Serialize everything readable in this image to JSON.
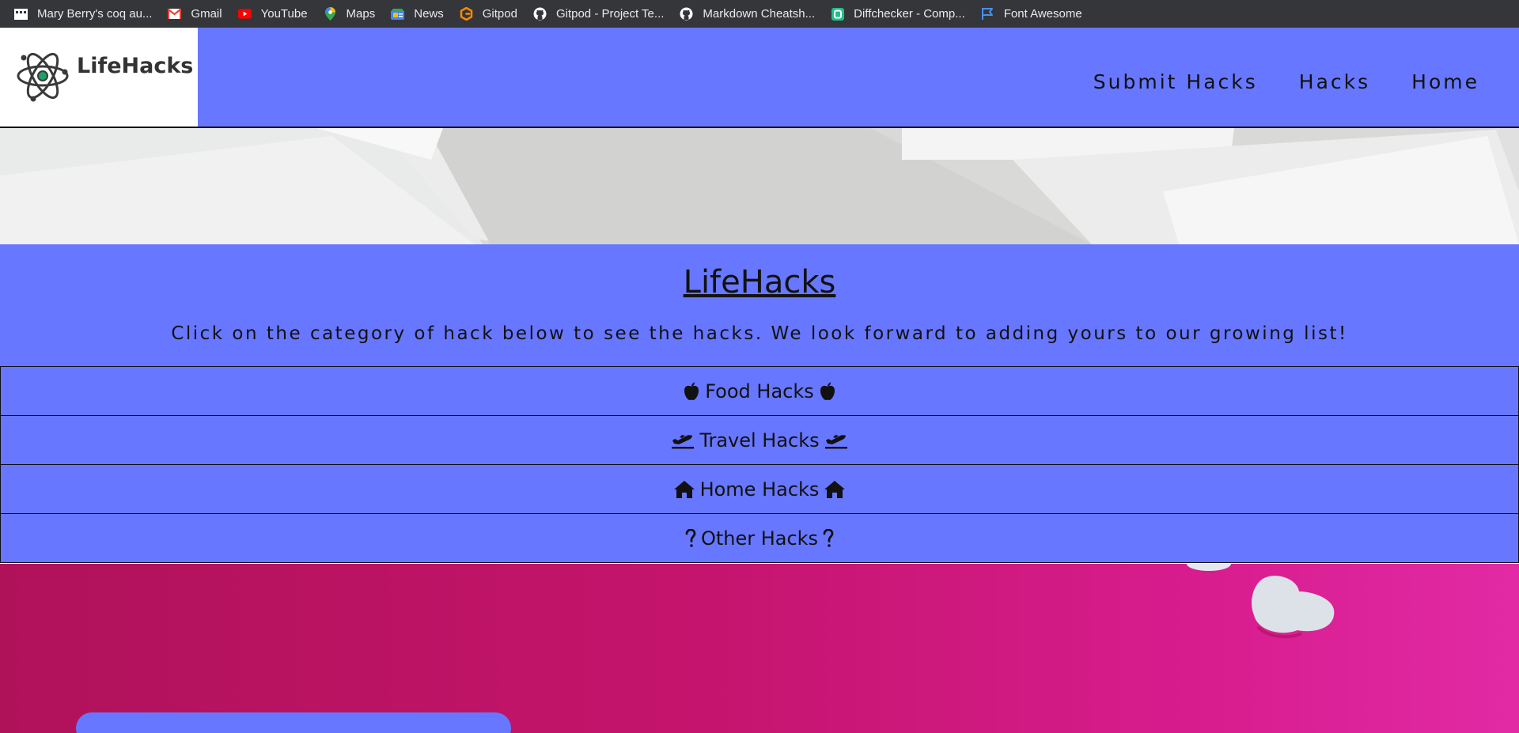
{
  "bookmarks": [
    {
      "label": "Mary Berry's coq au...",
      "icon": "mary-berry-favicon",
      "color": "#ffffff"
    },
    {
      "label": "Gmail",
      "icon": "gmail-icon",
      "color": "#ea4335"
    },
    {
      "label": "YouTube",
      "icon": "youtube-icon",
      "color": "#ff0000"
    },
    {
      "label": "Maps",
      "icon": "maps-icon",
      "color": "#34a853"
    },
    {
      "label": "News",
      "icon": "news-icon",
      "color": "#4285f4"
    },
    {
      "label": "Gitpod",
      "icon": "gitpod-icon",
      "color": "#ff8a00"
    },
    {
      "label": "Gitpod - Project Te...",
      "icon": "github-icon",
      "color": "#ffffff"
    },
    {
      "label": "Markdown Cheatsh...",
      "icon": "github-icon",
      "color": "#ffffff"
    },
    {
      "label": "Diffchecker - Comp...",
      "icon": "diffchecker-icon",
      "color": "#21c08b"
    },
    {
      "label": "Font Awesome",
      "icon": "flag-icon",
      "color": "#4a8fe7"
    }
  ],
  "navbar": {
    "logo_text": "LifeHacks",
    "links": [
      "Submit Hacks",
      "Hacks",
      "Home"
    ],
    "background": "#6777ff"
  },
  "intro": {
    "title": "LifeHacks",
    "subtitle": "Click on the category of hack below to see the hacks. We look forward to adding yours to our growing list!"
  },
  "categories": [
    {
      "label": "Food Hacks",
      "icon": "apple-icon"
    },
    {
      "label": "Travel Hacks",
      "icon": "plane-departure-icon"
    },
    {
      "label": "Home Hacks",
      "icon": "home-icon"
    },
    {
      "label": "Other Hacks",
      "icon": "question-icon"
    }
  ]
}
